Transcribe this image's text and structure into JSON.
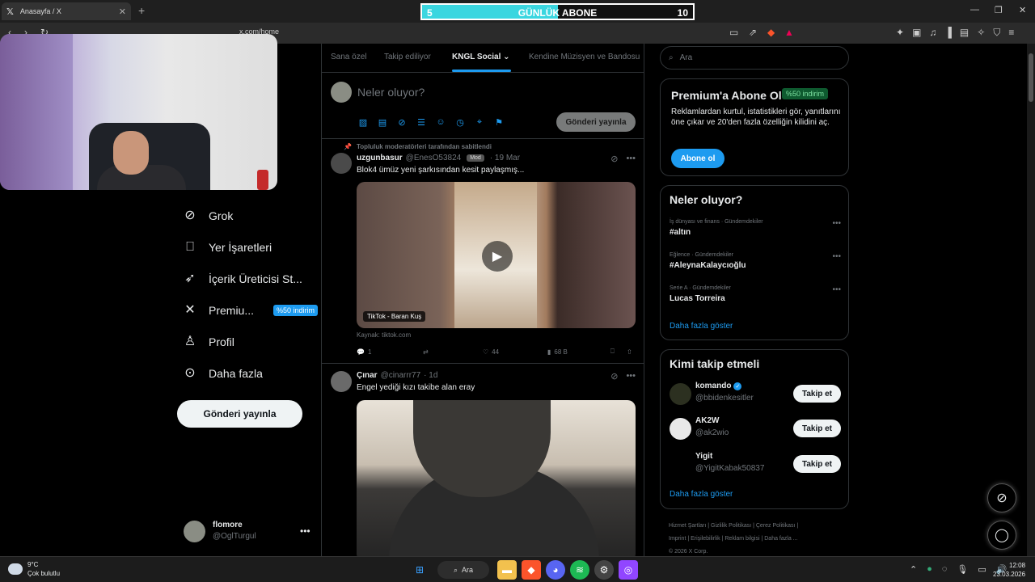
{
  "browser": {
    "tab_title": "Anasayfa / X",
    "url": "x.com/home"
  },
  "sub_goal": {
    "current": "5",
    "title": "GÜNLÜK ABONE",
    "target": "10",
    "progress": 0.5
  },
  "sidebar": {
    "items": [
      {
        "label": "Grok",
        "icon": "grok-icon"
      },
      {
        "label": "Yer İşaretleri",
        "icon": "bookmark-icon"
      },
      {
        "label": "İçerik Üreticisi St...",
        "icon": "rocket-icon"
      },
      {
        "label": "Premiu...",
        "icon": "x-logo-icon",
        "badge": "%50 indirim"
      },
      {
        "label": "Profil",
        "icon": "person-icon"
      },
      {
        "label": "Daha fazla",
        "icon": "more-circle-icon"
      }
    ],
    "post_button": "Gönderi yayınla",
    "account": {
      "name": "flomore",
      "handle": "@OglTurgul"
    }
  },
  "feed": {
    "tabs": [
      "Sana özel",
      "Takip ediliyor",
      "KNGL Social",
      "Kendine Müzisyen ve Bandosu"
    ],
    "active_tab": "KNGL Social",
    "compose_placeholder": "Neler oluyor?",
    "compose_post": "Gönderi yayınla",
    "tweets": [
      {
        "pinned_label": "Topluluk moderatörleri tarafından sabitlendi",
        "name": "uzgunbasur",
        "handle": "@EnesO53824",
        "badge": "Mod",
        "date": "· 19 Mar",
        "text": "Blok4 ümüz yeni şarkısından kesit paylaşmış...",
        "media_label": "TikTok - Baran Kuş",
        "source": "Kaynak: tiktok.com",
        "replies": "1",
        "likes": "44",
        "views": "68 B"
      },
      {
        "name": "Çınar",
        "handle": "@cinarrr77",
        "date": "· 1d",
        "text": "Engel yediği kızı takibe alan eray"
      }
    ]
  },
  "right": {
    "search_placeholder": "Ara",
    "premium": {
      "title": "Premium'a Abone Ol",
      "badge": "%50 indirim",
      "desc": "Reklamlardan kurtul, istatistikleri gör, yanıtlarını öne çıkar ve 20'den fazla özelliğin kilidini aç.",
      "button": "Abone ol"
    },
    "trends": {
      "title": "Neler oluyor?",
      "items": [
        {
          "category": "İş dünyası ve finans · Gündemdekiler",
          "tag": "#altın"
        },
        {
          "category": "Eğlence · Gündemdekiler",
          "tag": "#AleynaKalaycıoğlu"
        },
        {
          "category": "Serie A · Gündemdekiler",
          "tag": "Lucas Torreira"
        }
      ],
      "show_more": "Daha fazla göster"
    },
    "who_to_follow": {
      "title": "Kimi takip etmeli",
      "items": [
        {
          "name": "komando",
          "handle": "@bbidenkesitler",
          "verified": true,
          "button": "Takip et"
        },
        {
          "name": "AK2W",
          "handle": "@ak2wio",
          "button": "Takip et"
        },
        {
          "name": "Yigit",
          "handle": "@YigitKabak50837",
          "button": "Takip et"
        }
      ],
      "show_more": "Daha fazla göster"
    },
    "footer": {
      "line1": "Hizmet Şartları | Gizlilik Politikası | Çerez Politikası |",
      "line2": "Imprint | Erişilebilirlik | Reklam bilgisi | Daha fazla ...",
      "line3": "© 2026 X Corp."
    }
  },
  "taskbar": {
    "temp": "9°C",
    "weather": "Çok bulutlu",
    "search": "Ara",
    "time": "12:08",
    "date": "23.03.2026"
  }
}
